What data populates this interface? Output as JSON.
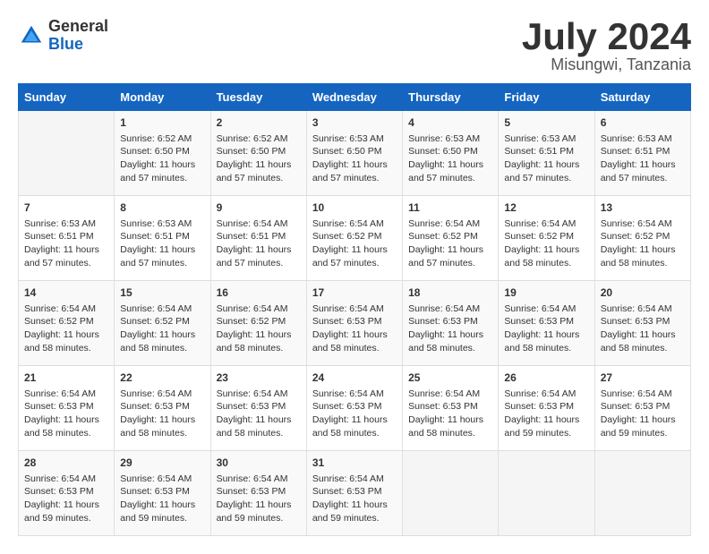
{
  "header": {
    "logo_general": "General",
    "logo_blue": "Blue",
    "main_title": "July 2024",
    "subtitle": "Misungwi, Tanzania"
  },
  "calendar": {
    "days_of_week": [
      "Sunday",
      "Monday",
      "Tuesday",
      "Wednesday",
      "Thursday",
      "Friday",
      "Saturday"
    ],
    "weeks": [
      [
        {
          "day": "",
          "info": ""
        },
        {
          "day": "1",
          "info": "Sunrise: 6:52 AM\nSunset: 6:50 PM\nDaylight: 11 hours\nand 57 minutes."
        },
        {
          "day": "2",
          "info": "Sunrise: 6:52 AM\nSunset: 6:50 PM\nDaylight: 11 hours\nand 57 minutes."
        },
        {
          "day": "3",
          "info": "Sunrise: 6:53 AM\nSunset: 6:50 PM\nDaylight: 11 hours\nand 57 minutes."
        },
        {
          "day": "4",
          "info": "Sunrise: 6:53 AM\nSunset: 6:50 PM\nDaylight: 11 hours\nand 57 minutes."
        },
        {
          "day": "5",
          "info": "Sunrise: 6:53 AM\nSunset: 6:51 PM\nDaylight: 11 hours\nand 57 minutes."
        },
        {
          "day": "6",
          "info": "Sunrise: 6:53 AM\nSunset: 6:51 PM\nDaylight: 11 hours\nand 57 minutes."
        }
      ],
      [
        {
          "day": "7",
          "info": "Sunrise: 6:53 AM\nSunset: 6:51 PM\nDaylight: 11 hours\nand 57 minutes."
        },
        {
          "day": "8",
          "info": "Sunrise: 6:53 AM\nSunset: 6:51 PM\nDaylight: 11 hours\nand 57 minutes."
        },
        {
          "day": "9",
          "info": "Sunrise: 6:54 AM\nSunset: 6:51 PM\nDaylight: 11 hours\nand 57 minutes."
        },
        {
          "day": "10",
          "info": "Sunrise: 6:54 AM\nSunset: 6:52 PM\nDaylight: 11 hours\nand 57 minutes."
        },
        {
          "day": "11",
          "info": "Sunrise: 6:54 AM\nSunset: 6:52 PM\nDaylight: 11 hours\nand 57 minutes."
        },
        {
          "day": "12",
          "info": "Sunrise: 6:54 AM\nSunset: 6:52 PM\nDaylight: 11 hours\nand 58 minutes."
        },
        {
          "day": "13",
          "info": "Sunrise: 6:54 AM\nSunset: 6:52 PM\nDaylight: 11 hours\nand 58 minutes."
        }
      ],
      [
        {
          "day": "14",
          "info": "Sunrise: 6:54 AM\nSunset: 6:52 PM\nDaylight: 11 hours\nand 58 minutes."
        },
        {
          "day": "15",
          "info": "Sunrise: 6:54 AM\nSunset: 6:52 PM\nDaylight: 11 hours\nand 58 minutes."
        },
        {
          "day": "16",
          "info": "Sunrise: 6:54 AM\nSunset: 6:52 PM\nDaylight: 11 hours\nand 58 minutes."
        },
        {
          "day": "17",
          "info": "Sunrise: 6:54 AM\nSunset: 6:53 PM\nDaylight: 11 hours\nand 58 minutes."
        },
        {
          "day": "18",
          "info": "Sunrise: 6:54 AM\nSunset: 6:53 PM\nDaylight: 11 hours\nand 58 minutes."
        },
        {
          "day": "19",
          "info": "Sunrise: 6:54 AM\nSunset: 6:53 PM\nDaylight: 11 hours\nand 58 minutes."
        },
        {
          "day": "20",
          "info": "Sunrise: 6:54 AM\nSunset: 6:53 PM\nDaylight: 11 hours\nand 58 minutes."
        }
      ],
      [
        {
          "day": "21",
          "info": "Sunrise: 6:54 AM\nSunset: 6:53 PM\nDaylight: 11 hours\nand 58 minutes."
        },
        {
          "day": "22",
          "info": "Sunrise: 6:54 AM\nSunset: 6:53 PM\nDaylight: 11 hours\nand 58 minutes."
        },
        {
          "day": "23",
          "info": "Sunrise: 6:54 AM\nSunset: 6:53 PM\nDaylight: 11 hours\nand 58 minutes."
        },
        {
          "day": "24",
          "info": "Sunrise: 6:54 AM\nSunset: 6:53 PM\nDaylight: 11 hours\nand 58 minutes."
        },
        {
          "day": "25",
          "info": "Sunrise: 6:54 AM\nSunset: 6:53 PM\nDaylight: 11 hours\nand 58 minutes."
        },
        {
          "day": "26",
          "info": "Sunrise: 6:54 AM\nSunset: 6:53 PM\nDaylight: 11 hours\nand 59 minutes."
        },
        {
          "day": "27",
          "info": "Sunrise: 6:54 AM\nSunset: 6:53 PM\nDaylight: 11 hours\nand 59 minutes."
        }
      ],
      [
        {
          "day": "28",
          "info": "Sunrise: 6:54 AM\nSunset: 6:53 PM\nDaylight: 11 hours\nand 59 minutes."
        },
        {
          "day": "29",
          "info": "Sunrise: 6:54 AM\nSunset: 6:53 PM\nDaylight: 11 hours\nand 59 minutes."
        },
        {
          "day": "30",
          "info": "Sunrise: 6:54 AM\nSunset: 6:53 PM\nDaylight: 11 hours\nand 59 minutes."
        },
        {
          "day": "31",
          "info": "Sunrise: 6:54 AM\nSunset: 6:53 PM\nDaylight: 11 hours\nand 59 minutes."
        },
        {
          "day": "",
          "info": ""
        },
        {
          "day": "",
          "info": ""
        },
        {
          "day": "",
          "info": ""
        }
      ]
    ]
  }
}
